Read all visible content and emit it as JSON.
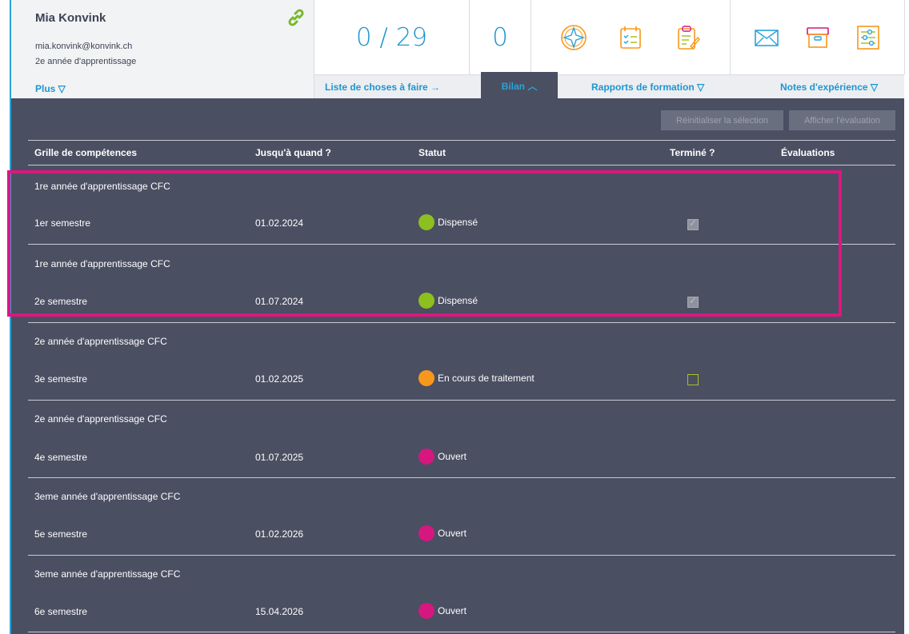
{
  "profile": {
    "name": "Mia Konvink",
    "email": "mia.konvink@konvink.ch",
    "year": "2e année d'apprentissage",
    "more_label": "Plus ▽"
  },
  "stats": {
    "progress": "0 / 29",
    "count": "0"
  },
  "icons": {
    "link": "link-icon",
    "row1": [
      "compass-icon",
      "checklist-icon",
      "clipboard-edit-icon"
    ],
    "row2": [
      "envelope-icon",
      "archive-box-icon",
      "sliders-icon"
    ]
  },
  "tabs": [
    {
      "label": "Liste de choses à faire →"
    },
    {
      "label": "Bilan ︿"
    },
    {
      "label": "Rapports de formation ▽"
    },
    {
      "label": "Notes d'expérience ▽"
    }
  ],
  "buttons": {
    "reset": "Réinitialiser la sélection",
    "show": "Afficher l'évaluation"
  },
  "table": {
    "headers": [
      "Grille de compétences",
      "Jusqu'à quand ?",
      "Statut",
      "Terminé ?",
      "Évaluations"
    ],
    "rows": [
      {
        "group": "1re année d'apprentissage CFC",
        "semester": "1er semestre",
        "date": "01.02.2024",
        "status": "Dispensé",
        "done": "checked"
      },
      {
        "group": "1re année d'apprentissage CFC",
        "semester": "2e semestre",
        "date": "01.07.2024",
        "status": "Dispensé",
        "done": "checked"
      },
      {
        "group": "2e année d'apprentissage CFC",
        "semester": "3e semestre",
        "date": "01.02.2025",
        "status": "En cours de traitement",
        "done": "empty"
      },
      {
        "group": "2e année d'apprentissage CFC",
        "semester": "4e semestre",
        "date": "01.07.2025",
        "status": "Ouvert",
        "done": "none"
      },
      {
        "group": "3eme année d'apprentissage CFC",
        "semester": "5e semestre",
        "date": "01.02.2026",
        "status": "Ouvert",
        "done": "none"
      },
      {
        "group": "3eme année d'apprentissage CFC",
        "semester": "6e semestre",
        "date": "15.04.2026",
        "status": "Ouvert",
        "done": "none"
      }
    ]
  },
  "status_colors": {
    "Dispensé": "#8dbf1e",
    "En cours de traitement": "#f7981d",
    "Ouvert": "#d6177f"
  },
  "colors": {
    "accent": "#1f95d1",
    "highlight": "#e0157e",
    "panel": "#4a4f62"
  }
}
